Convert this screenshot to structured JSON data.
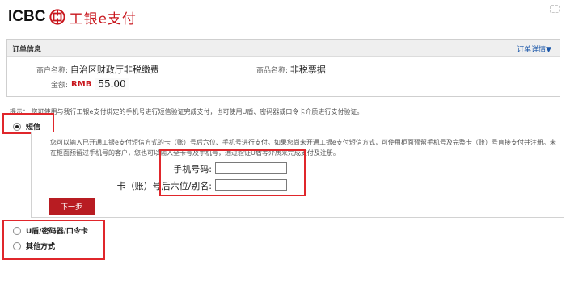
{
  "header": {
    "logo_text": "ICBC",
    "brand": "工银e支付"
  },
  "order": {
    "title": "订单信息",
    "detail_link": "订单详情▼",
    "merchant_label": "商户名称:",
    "merchant_value": "自治区财政厅非税缴费",
    "product_label": "商品名称:",
    "product_value": "非税票据",
    "amount_label": "金额:",
    "currency": "RMB",
    "amount": "55.00"
  },
  "tip": "提示： 您可使用与我行工银e支付绑定的手机号进行短信验证完成支付，也可使用U盾、密码器或口令卡介质进行支付验证。",
  "methods": {
    "sms": {
      "label": "短信",
      "selected": true
    },
    "ukey": {
      "label": "U盾/密码器/口令卡",
      "selected": false
    },
    "other": {
      "label": "其他方式",
      "selected": false
    }
  },
  "sms_panel": {
    "description": "您可以输入已开通工银e支付短信方式的卡（账）号后六位、手机号进行支付。如果您尚未开通工银e支付短信方式，可使用柜面预留手机号及完整卡（账）号直接支付并注册。未在柜面预留过手机号的客户，您也可以输入全卡号及手机号，通过验证U盾等介质来完成支付及注册。",
    "phone_label": "手机号码:",
    "phone_value": "",
    "card_label": "卡（账）号后六位/别名:",
    "card_value": "",
    "next_button": "下一步"
  },
  "colors": {
    "brand_red": "#c8161d",
    "annotation_red": "#e0262b",
    "link_blue": "#1a56a8"
  }
}
